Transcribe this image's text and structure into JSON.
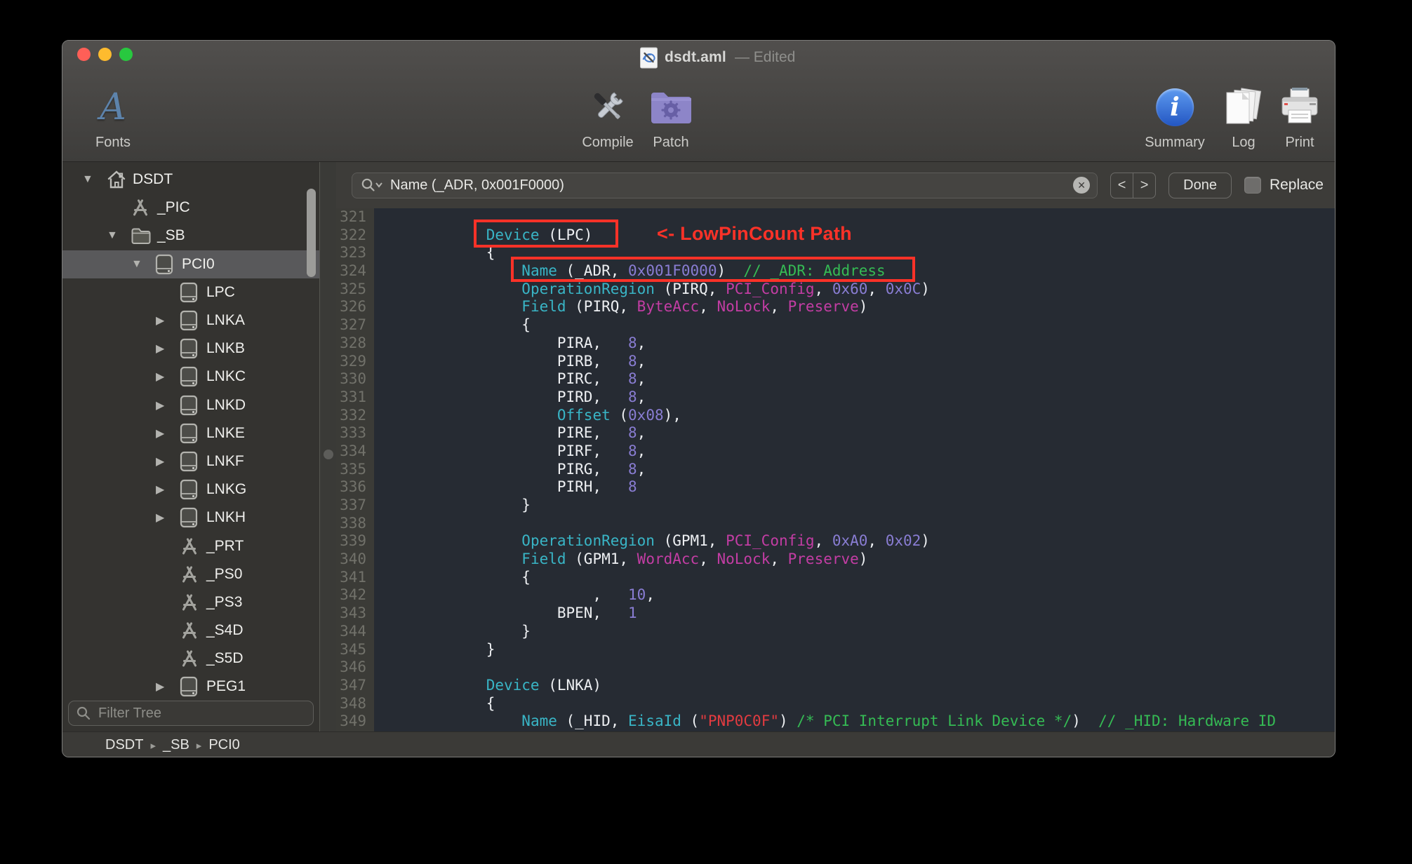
{
  "window": {
    "title": "dsdt.aml",
    "modified_suffix": "— Edited"
  },
  "toolbar": {
    "fonts_label": "Fonts",
    "compile_label": "Compile",
    "patch_label": "Patch",
    "summary_label": "Summary",
    "log_label": "Log",
    "print_label": "Print"
  },
  "search": {
    "value": "Name (_ADR, 0x001F0000)",
    "prev_label": "<",
    "next_label": ">",
    "done_label": "Done",
    "replace_label": "Replace",
    "clear_glyph": "✕"
  },
  "sidebar": {
    "filter_placeholder": "Filter Tree",
    "items": [
      {
        "label": "DSDT",
        "icon": "house",
        "level": 0,
        "disclosure": "open",
        "selected": false
      },
      {
        "label": "_PIC",
        "icon": "method",
        "level": 1,
        "disclosure": "none",
        "selected": false
      },
      {
        "label": "_SB",
        "icon": "folder",
        "level": 1,
        "disclosure": "open",
        "selected": false
      },
      {
        "label": "PCI0",
        "icon": "device",
        "level": 2,
        "disclosure": "open",
        "selected": true
      },
      {
        "label": "LPC",
        "icon": "device",
        "level": 3,
        "disclosure": "none",
        "selected": false
      },
      {
        "label": "LNKA",
        "icon": "device",
        "level": 3,
        "disclosure": "closed",
        "selected": false
      },
      {
        "label": "LNKB",
        "icon": "device",
        "level": 3,
        "disclosure": "closed",
        "selected": false
      },
      {
        "label": "LNKC",
        "icon": "device",
        "level": 3,
        "disclosure": "closed",
        "selected": false
      },
      {
        "label": "LNKD",
        "icon": "device",
        "level": 3,
        "disclosure": "closed",
        "selected": false
      },
      {
        "label": "LNKE",
        "icon": "device",
        "level": 3,
        "disclosure": "closed",
        "selected": false
      },
      {
        "label": "LNKF",
        "icon": "device",
        "level": 3,
        "disclosure": "closed",
        "selected": false
      },
      {
        "label": "LNKG",
        "icon": "device",
        "level": 3,
        "disclosure": "closed",
        "selected": false
      },
      {
        "label": "LNKH",
        "icon": "device",
        "level": 3,
        "disclosure": "closed",
        "selected": false
      },
      {
        "label": "_PRT",
        "icon": "method",
        "level": 3,
        "disclosure": "none",
        "selected": false
      },
      {
        "label": "_PS0",
        "icon": "method",
        "level": 3,
        "disclosure": "none",
        "selected": false
      },
      {
        "label": "_PS3",
        "icon": "method",
        "level": 3,
        "disclosure": "none",
        "selected": false
      },
      {
        "label": "_S4D",
        "icon": "method",
        "level": 3,
        "disclosure": "none",
        "selected": false
      },
      {
        "label": "_S5D",
        "icon": "method",
        "level": 3,
        "disclosure": "none",
        "selected": false
      },
      {
        "label": "PEG1",
        "icon": "device",
        "level": 3,
        "disclosure": "closed",
        "selected": false
      }
    ]
  },
  "statusbar": {
    "breadcrumb": [
      "DSDT",
      "_SB",
      "PCI0"
    ]
  },
  "editor": {
    "annotation": "<- LowPinCount Path",
    "first_line": 321,
    "lines": [
      {
        "n": 321,
        "seg": []
      },
      {
        "n": 322,
        "seg": [
          [
            "p",
            "            "
          ],
          [
            "k",
            "Device"
          ],
          [
            "p",
            " (LPC)"
          ]
        ]
      },
      {
        "n": 323,
        "seg": [
          [
            "p",
            "            {"
          ]
        ]
      },
      {
        "n": 324,
        "seg": [
          [
            "p",
            "                "
          ],
          [
            "k",
            "Name"
          ],
          [
            "p",
            " (_ADR, "
          ],
          [
            "n",
            "0x001F0000"
          ],
          [
            "p",
            ")  "
          ],
          [
            "c",
            "// _ADR: Address"
          ]
        ]
      },
      {
        "n": 325,
        "seg": [
          [
            "p",
            "                "
          ],
          [
            "k",
            "OperationRegion"
          ],
          [
            "p",
            " (PIRQ, "
          ],
          [
            "a",
            "PCI_Config"
          ],
          [
            "p",
            ", "
          ],
          [
            "n",
            "0x60"
          ],
          [
            "p",
            ", "
          ],
          [
            "n",
            "0x0C"
          ],
          [
            "p",
            ")"
          ]
        ]
      },
      {
        "n": 326,
        "seg": [
          [
            "p",
            "                "
          ],
          [
            "k",
            "Field"
          ],
          [
            "p",
            " (PIRQ, "
          ],
          [
            "a",
            "ByteAcc"
          ],
          [
            "p",
            ", "
          ],
          [
            "a",
            "NoLock"
          ],
          [
            "p",
            ", "
          ],
          [
            "a",
            "Preserve"
          ],
          [
            "p",
            ")"
          ]
        ]
      },
      {
        "n": 327,
        "seg": [
          [
            "p",
            "                {"
          ]
        ]
      },
      {
        "n": 328,
        "seg": [
          [
            "p",
            "                    PIRA,   "
          ],
          [
            "n",
            "8"
          ],
          [
            "p",
            ","
          ]
        ]
      },
      {
        "n": 329,
        "seg": [
          [
            "p",
            "                    PIRB,   "
          ],
          [
            "n",
            "8"
          ],
          [
            "p",
            ","
          ]
        ]
      },
      {
        "n": 330,
        "seg": [
          [
            "p",
            "                    PIRC,   "
          ],
          [
            "n",
            "8"
          ],
          [
            "p",
            ","
          ]
        ]
      },
      {
        "n": 331,
        "seg": [
          [
            "p",
            "                    PIRD,   "
          ],
          [
            "n",
            "8"
          ],
          [
            "p",
            ","
          ]
        ]
      },
      {
        "n": 332,
        "seg": [
          [
            "p",
            "                    "
          ],
          [
            "k",
            "Offset"
          ],
          [
            "p",
            " ("
          ],
          [
            "n",
            "0x08"
          ],
          [
            "p",
            "),"
          ]
        ]
      },
      {
        "n": 333,
        "seg": [
          [
            "p",
            "                    PIRE,   "
          ],
          [
            "n",
            "8"
          ],
          [
            "p",
            ","
          ]
        ]
      },
      {
        "n": 334,
        "seg": [
          [
            "p",
            "                    PIRF,   "
          ],
          [
            "n",
            "8"
          ],
          [
            "p",
            ","
          ]
        ]
      },
      {
        "n": 335,
        "seg": [
          [
            "p",
            "                    PIRG,   "
          ],
          [
            "n",
            "8"
          ],
          [
            "p",
            ","
          ]
        ]
      },
      {
        "n": 336,
        "seg": [
          [
            "p",
            "                    PIRH,   "
          ],
          [
            "n",
            "8"
          ]
        ]
      },
      {
        "n": 337,
        "seg": [
          [
            "p",
            "                }"
          ]
        ]
      },
      {
        "n": 338,
        "seg": []
      },
      {
        "n": 339,
        "seg": [
          [
            "p",
            "                "
          ],
          [
            "k",
            "OperationRegion"
          ],
          [
            "p",
            " (GPM1, "
          ],
          [
            "a",
            "PCI_Config"
          ],
          [
            "p",
            ", "
          ],
          [
            "n",
            "0xA0"
          ],
          [
            "p",
            ", "
          ],
          [
            "n",
            "0x02"
          ],
          [
            "p",
            ")"
          ]
        ]
      },
      {
        "n": 340,
        "seg": [
          [
            "p",
            "                "
          ],
          [
            "k",
            "Field"
          ],
          [
            "p",
            " (GPM1, "
          ],
          [
            "a",
            "WordAcc"
          ],
          [
            "p",
            ", "
          ],
          [
            "a",
            "NoLock"
          ],
          [
            "p",
            ", "
          ],
          [
            "a",
            "Preserve"
          ],
          [
            "p",
            ")"
          ]
        ]
      },
      {
        "n": 341,
        "seg": [
          [
            "p",
            "                {"
          ]
        ]
      },
      {
        "n": 342,
        "seg": [
          [
            "p",
            "                        ,   "
          ],
          [
            "n",
            "10"
          ],
          [
            "p",
            ","
          ]
        ]
      },
      {
        "n": 343,
        "seg": [
          [
            "p",
            "                    BPEN,   "
          ],
          [
            "n",
            "1"
          ]
        ]
      },
      {
        "n": 344,
        "seg": [
          [
            "p",
            "                }"
          ]
        ]
      },
      {
        "n": 345,
        "seg": [
          [
            "p",
            "            }"
          ]
        ]
      },
      {
        "n": 346,
        "seg": []
      },
      {
        "n": 347,
        "seg": [
          [
            "p",
            "            "
          ],
          [
            "k",
            "Device"
          ],
          [
            "p",
            " (LNKA)"
          ]
        ]
      },
      {
        "n": 348,
        "seg": [
          [
            "p",
            "            {"
          ]
        ]
      },
      {
        "n": 349,
        "seg": [
          [
            "p",
            "                "
          ],
          [
            "k",
            "Name"
          ],
          [
            "p",
            " (_HID, "
          ],
          [
            "k",
            "EisaId"
          ],
          [
            "p",
            " ("
          ],
          [
            "s",
            "\"PNP0C0F\""
          ],
          [
            "p",
            ") "
          ],
          [
            "c",
            "/* PCI Interrupt Link Device */"
          ],
          [
            "p",
            ")  "
          ],
          [
            "c",
            "// _HID: Hardware ID"
          ]
        ]
      }
    ]
  },
  "colors": {
    "keyword": "#39b5c6",
    "plain": "#edeff2",
    "number": "#897dd3",
    "argument": "#c33da4",
    "comment": "#35bb54",
    "string": "#e23b40",
    "annotation_red": "#fb3228",
    "traffic_close": "#ff5f57",
    "traffic_min": "#febb2e",
    "traffic_zoom": "#28c83f"
  }
}
